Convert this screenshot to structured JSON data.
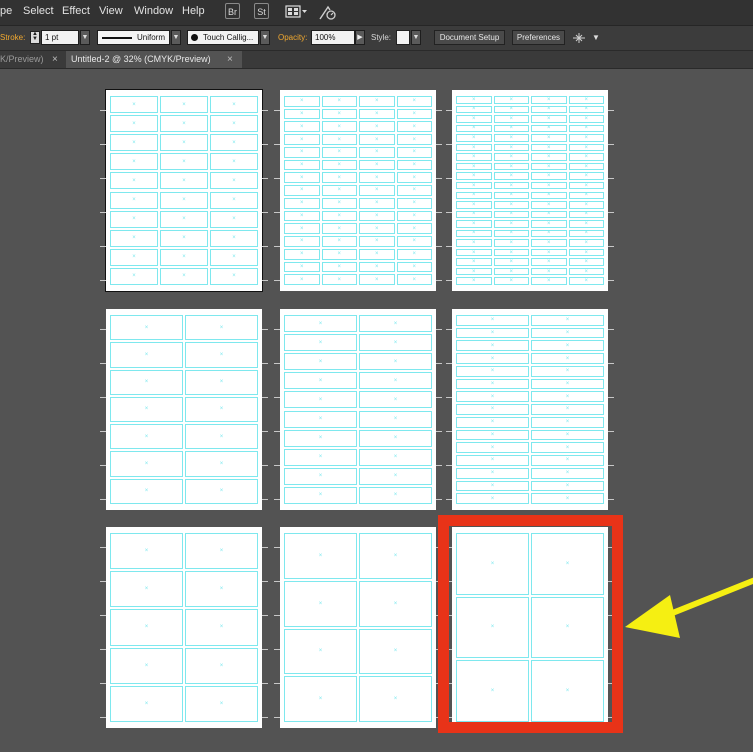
{
  "menubar": {
    "items": [
      "pe",
      "Select",
      "Effect",
      "View",
      "Window",
      "Help"
    ],
    "bridge_label": "Br",
    "stock_label": "St"
  },
  "controlbar": {
    "stroke_label": "Stroke:",
    "stroke_value": "1 pt",
    "profile_value": "Uniform",
    "brush_value": "Touch Callig...",
    "opacity_label": "Opacity:",
    "opacity_value": "100%",
    "style_label": "Style:",
    "document_setup_label": "Document Setup",
    "preferences_label": "Preferences"
  },
  "tabs": [
    {
      "label": "K/Preview)",
      "active": false
    },
    {
      "label": "Untitled-2 @ 32% (CMYK/Preview)",
      "active": true
    }
  ],
  "artboards": [
    {
      "name": "artboard-1",
      "cols": 3,
      "rows": 10,
      "selected": true
    },
    {
      "name": "artboard-2",
      "cols": 4,
      "rows": 15,
      "selected": false
    },
    {
      "name": "artboard-3",
      "cols": 4,
      "rows": 20,
      "selected": false
    },
    {
      "name": "artboard-4",
      "cols": 2,
      "rows": 7,
      "selected": false
    },
    {
      "name": "artboard-5",
      "cols": 2,
      "rows": 10,
      "selected": false
    },
    {
      "name": "artboard-6",
      "cols": 2,
      "rows": 15,
      "selected": false
    },
    {
      "name": "artboard-7",
      "cols": 2,
      "rows": 5,
      "selected": false
    },
    {
      "name": "artboard-8",
      "cols": 2,
      "rows": 4,
      "selected": false
    },
    {
      "name": "artboard-9",
      "cols": 2,
      "rows": 3,
      "selected": false
    }
  ],
  "annotation": {
    "highlight_color": "#e83318",
    "arrow_color": "#f5ef12"
  },
  "colors": {
    "guide_cyan": "#7ee8ee",
    "canvas_bg": "#535353"
  }
}
